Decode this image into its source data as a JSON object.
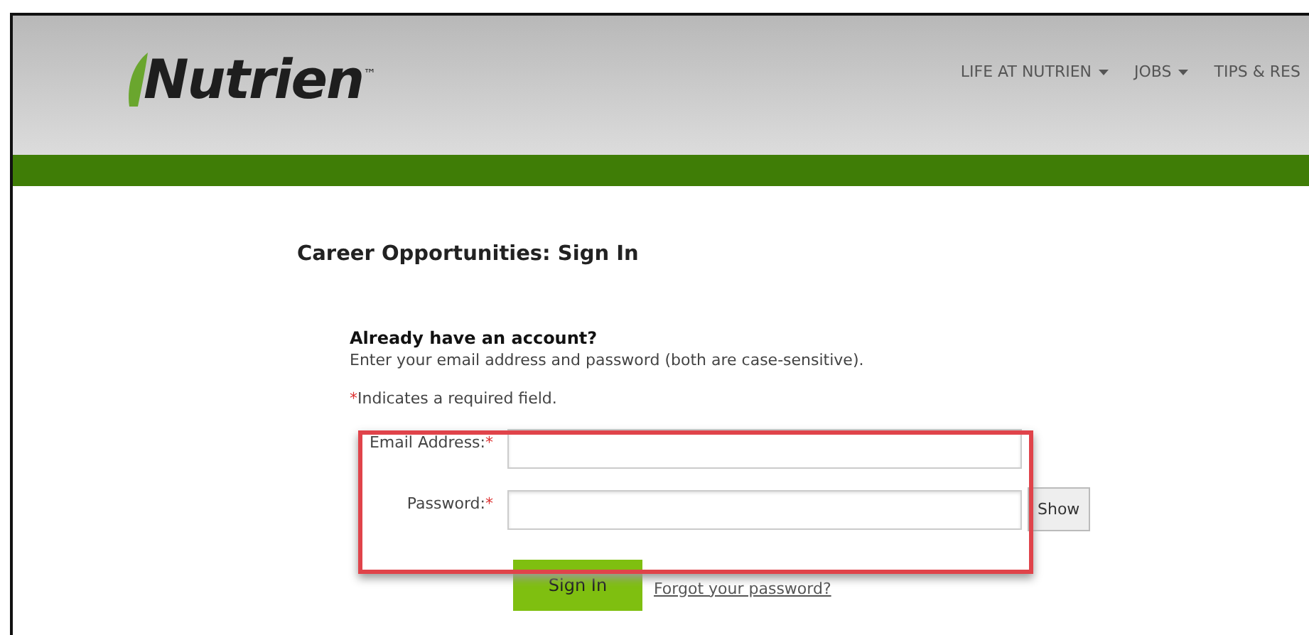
{
  "header": {
    "logo": {
      "text": "Nutrien",
      "trademark": "™"
    },
    "nav": [
      {
        "label": "LIFE AT NUTRIEN",
        "dropdown": true
      },
      {
        "label": "JOBS",
        "dropdown": true
      },
      {
        "label": "TIPS & RES",
        "dropdown": false
      }
    ]
  },
  "page_title": "Career Opportunities: Sign In",
  "sign_in": {
    "heading": "Already have an account?",
    "instructions": "Enter your email address and password (both are case-sensitive).",
    "required_note": {
      "mark": "*",
      "text": "Indicates a required field."
    },
    "fields": [
      {
        "label": "Email Address:",
        "required_mark": "*"
      },
      {
        "label": "Password:",
        "required_mark": "*",
        "toggle": "Show"
      }
    ],
    "submit": "Sign In",
    "forgot_link": "Forgot your password?"
  }
}
